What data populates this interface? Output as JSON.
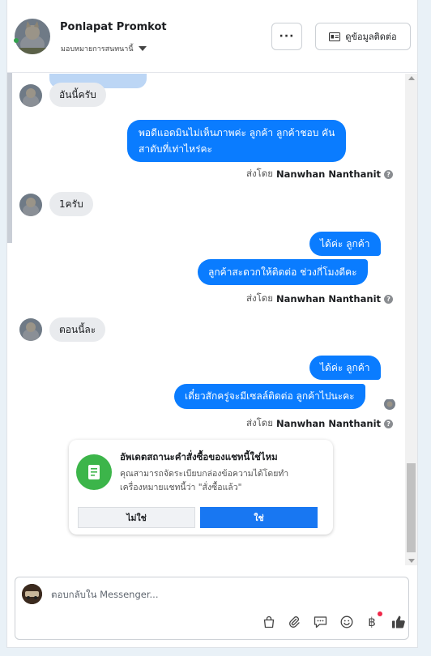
{
  "header": {
    "contact_name": "Ponlapat Promkot",
    "assign_label": "มอบหมายการสนทนานี้",
    "more_label": "···",
    "contact_info_label": "ดูข้อมูลติดต่อ"
  },
  "messages": {
    "m1": "อันนี้ครับ",
    "m2_line1": "พอดีแอดมินไม่เห็นภาพค่ะ ลูกค้า ลูกค้าชอบ คัน",
    "m2_line2": "สาดับที่เท่าไหร่คะ",
    "m3": "1ครับ",
    "m4": "ได้ค่ะ ลูกค้า",
    "m5": "ลูกค้าสะดวกให้ติดต่อ ช่วงกี่โมงดีคะ",
    "m6": "ตอนนี้ละ",
    "m7": "ได้ค่ะ ลูกค้า",
    "m8": "เดี๋ยวสักครู่จะมีเซลล์ติดต่อ ลูกค้าไปนะคะ"
  },
  "sent_by": {
    "prefix": "ส่งโดย",
    "agent": "Nanwhan Nanthanit",
    "help_glyph": "?"
  },
  "order_card": {
    "title": "อัพเดตสถานะคำสั่งซื้อของแชทนี้ใช่ไหม",
    "description": "คุณสามารถจัดระเบียบกล่องข้อความได้โดยทำเครื่องหมายแชทนี้ว่า \"สั่งซื้อแล้ว\"",
    "no_label": "ไม่ใช่",
    "yes_label": "ใช่",
    "icon": "order-receipt-icon"
  },
  "composer": {
    "placeholder": "ตอบกลับใน Messenger...",
    "tools": [
      "shopping-bag-icon",
      "paperclip-icon",
      "saved-replies-icon",
      "emoji-icon",
      "baht-payment-icon",
      "thumbs-up-icon"
    ],
    "baht_glyph": "฿"
  },
  "colors": {
    "outgoing_bubble": "#0a7cff",
    "incoming_bubble": "#e9ebee",
    "yes_button": "#1877f2",
    "order_icon_bg": "#3cb54a"
  }
}
